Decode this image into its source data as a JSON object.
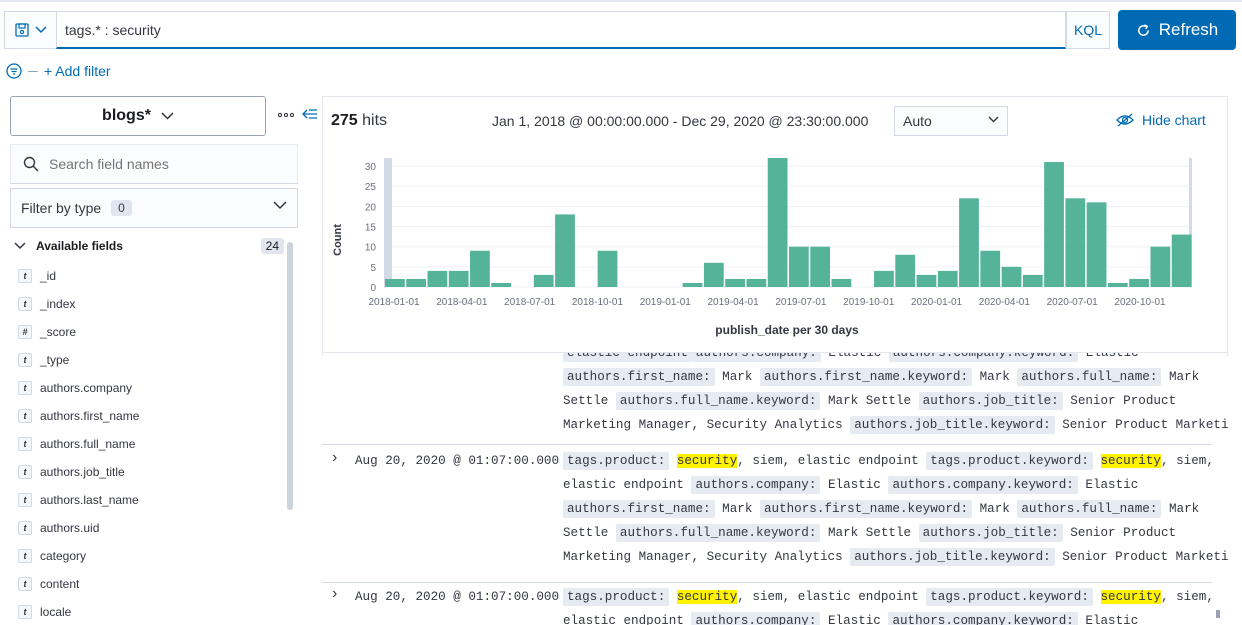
{
  "query": {
    "value": "tags.* : security",
    "language": "KQL",
    "refresh_label": "Refresh"
  },
  "filters": {
    "add_label": "+ Add filter"
  },
  "sidebar": {
    "index_pattern": "blogs*",
    "search_placeholder": "Search field names",
    "filter_type_label": "Filter by type",
    "filter_type_count": "0",
    "available_label": "Available fields",
    "available_count": "24",
    "fields": [
      {
        "type": "t",
        "name": "_id"
      },
      {
        "type": "t",
        "name": "_index"
      },
      {
        "type": "#",
        "name": "_score"
      },
      {
        "type": "t",
        "name": "_type"
      },
      {
        "type": "t",
        "name": "authors.company"
      },
      {
        "type": "t",
        "name": "authors.first_name"
      },
      {
        "type": "t",
        "name": "authors.full_name"
      },
      {
        "type": "t",
        "name": "authors.job_title"
      },
      {
        "type": "t",
        "name": "authors.last_name"
      },
      {
        "type": "t",
        "name": "authors.uid"
      },
      {
        "type": "t",
        "name": "category"
      },
      {
        "type": "t",
        "name": "content"
      },
      {
        "type": "t",
        "name": "locale"
      }
    ]
  },
  "results": {
    "hits_count": "275",
    "hits_label": "hits",
    "date_range": "Jan 1, 2018 @ 00:00:00.000 - Dec 29, 2020 @ 23:30:00.000",
    "interval": "Auto",
    "hide_chart_label": "Hide chart"
  },
  "chart_data": {
    "type": "bar",
    "title": "",
    "xlabel": "publish_date per 30 days",
    "ylabel": "Count",
    "ylim": [
      0,
      32
    ],
    "yticks": [
      0,
      5,
      10,
      15,
      20,
      25,
      30
    ],
    "xtick_labels": [
      "2018-01-01",
      "2018-04-01",
      "2018-07-01",
      "2018-10-01",
      "2019-01-01",
      "2019-04-01",
      "2019-07-01",
      "2019-10-01",
      "2020-01-01",
      "2020-04-01",
      "2020-07-01",
      "2020-10-01"
    ],
    "values": [
      2,
      2,
      4,
      4,
      9,
      1,
      0,
      3,
      18,
      0,
      9,
      0,
      0,
      0,
      1,
      6,
      2,
      2,
      32,
      10,
      10,
      2,
      0,
      4,
      8,
      3,
      4,
      22,
      9,
      5,
      3,
      31,
      22,
      21,
      1,
      2,
      10,
      13
    ],
    "color": "#54b399"
  },
  "documents": {
    "partial_lines": [
      [
        {
          "k": "elastic endpoint"
        },
        {
          "k": "authors.company:"
        },
        {
          "v": " Elastic "
        },
        {
          "k": "authors.company.keyword:"
        },
        {
          "v": " Elastic"
        }
      ],
      [
        {
          "k": "authors.first_name:"
        },
        {
          "v": " Mark "
        },
        {
          "k": "authors.first_name.keyword:"
        },
        {
          "v": " Mark "
        },
        {
          "k": "authors.full_name:"
        },
        {
          "v": " Mark"
        }
      ],
      [
        {
          "v": "Settle "
        },
        {
          "k": "authors.full_name.keyword:"
        },
        {
          "v": " Mark Settle "
        },
        {
          "k": "authors.job_title:"
        },
        {
          "v": " Senior Product"
        }
      ],
      [
        {
          "v": "Marketing Manager, Security Analytics "
        },
        {
          "k": "authors.job_title.keyword:"
        },
        {
          "v": " Senior Product Marketing"
        }
      ]
    ],
    "rows": [
      {
        "timestamp": "Aug 20, 2020 @ 01:07:00.000",
        "lines": [
          [
            {
              "k": "tags.product:"
            },
            {
              "v": " "
            },
            {
              "h": "security"
            },
            {
              "v": ", siem, elastic endpoint "
            },
            {
              "k": "tags.product.keyword:"
            },
            {
              "v": " "
            },
            {
              "h": "security"
            },
            {
              "v": ", siem,"
            }
          ],
          [
            {
              "v": "elastic endpoint "
            },
            {
              "k": "authors.company:"
            },
            {
              "v": " Elastic "
            },
            {
              "k": "authors.company.keyword:"
            },
            {
              "v": " Elastic"
            }
          ],
          [
            {
              "k": "authors.first_name:"
            },
            {
              "v": " Mark "
            },
            {
              "k": "authors.first_name.keyword:"
            },
            {
              "v": " Mark "
            },
            {
              "k": "authors.full_name:"
            },
            {
              "v": " Mark"
            }
          ],
          [
            {
              "v": "Settle "
            },
            {
              "k": "authors.full_name.keyword:"
            },
            {
              "v": " Mark Settle "
            },
            {
              "k": "authors.job_title:"
            },
            {
              "v": " Senior Product"
            }
          ],
          [
            {
              "v": "Marketing Manager, Security Analytics "
            },
            {
              "k": "authors.job_title.keyword:"
            },
            {
              "v": " Senior Product Marketing"
            }
          ]
        ]
      },
      {
        "timestamp": "Aug 20, 2020 @ 01:07:00.000",
        "lines": [
          [
            {
              "k": "tags.product:"
            },
            {
              "v": " "
            },
            {
              "h": "security"
            },
            {
              "v": ", siem, elastic endpoint "
            },
            {
              "k": "tags.product.keyword:"
            },
            {
              "v": " "
            },
            {
              "h": "security"
            },
            {
              "v": ", siem,"
            }
          ],
          [
            {
              "v": "elastic endpoint "
            },
            {
              "k": "authors.company:"
            },
            {
              "v": " Elastic "
            },
            {
              "k": "authors.company.keyword:"
            },
            {
              "v": " Elastic"
            }
          ]
        ]
      }
    ]
  }
}
